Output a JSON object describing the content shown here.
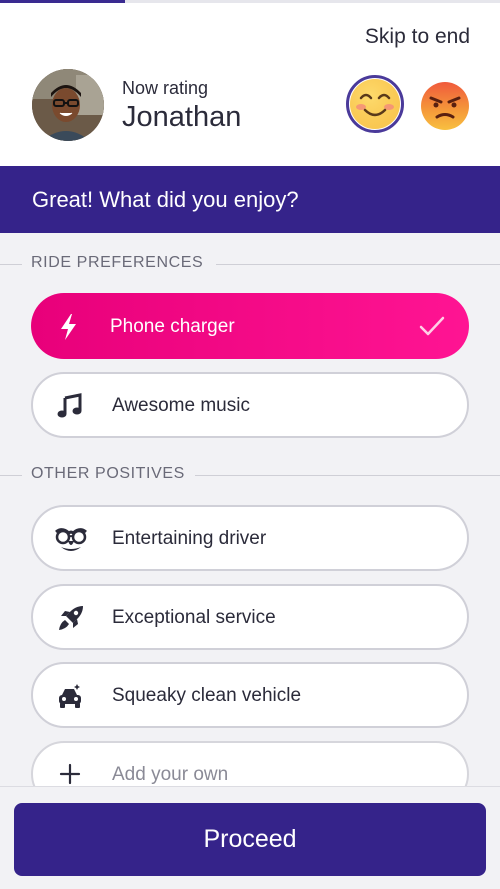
{
  "progress": {
    "fraction": 0.25,
    "color": "#3a2a90"
  },
  "header": {
    "skip_label": "Skip to end",
    "now_rating_label": "Now rating",
    "driver_name": "Jonathan",
    "emojis": [
      "smiling-face-icon",
      "angry-face-icon"
    ]
  },
  "banner": {
    "text": "Great! What did you enjoy?"
  },
  "sections": [
    {
      "title": "RIDE PREFERENCES",
      "options": [
        {
          "label": "Phone charger",
          "icon": "lightning-bolt-icon",
          "selected": true
        },
        {
          "label": "Awesome music",
          "icon": "music-note-icon",
          "selected": false
        }
      ]
    },
    {
      "title": "OTHER POSITIVES",
      "options": [
        {
          "label": "Entertaining driver",
          "icon": "disguise-glasses-icon",
          "selected": false
        },
        {
          "label": "Exceptional service",
          "icon": "rocket-icon",
          "selected": false
        },
        {
          "label": "Squeaky clean vehicle",
          "icon": "clean-car-icon",
          "selected": false
        },
        {
          "label": "Add your own",
          "icon": "plus-icon",
          "selected": false
        }
      ]
    }
  ],
  "footer": {
    "proceed_label": "Proceed"
  },
  "colors": {
    "brand": "#35238a",
    "accent": "#ff1493",
    "background": "#f2f2f5"
  }
}
